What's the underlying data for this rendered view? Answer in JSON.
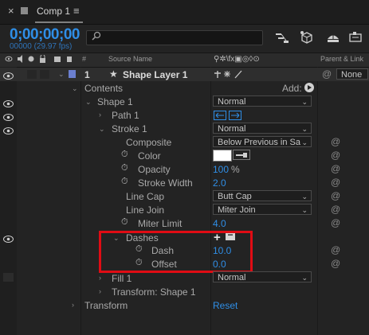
{
  "tab": {
    "close": "×",
    "title": "Comp 1",
    "menu": "≡"
  },
  "timecode": {
    "value": "0;00;00;00",
    "sub": "00000 (29.97 fps)"
  },
  "search": {
    "placeholder": ""
  },
  "columns": {
    "label": "#",
    "source_name": "Source Name",
    "parent_link": "Parent & Link",
    "switch_icons": "⚲✲\\fx▣◎◊⊙"
  },
  "layer": {
    "index": "1",
    "star": "★",
    "name": "Shape Layer 1",
    "parent_value": "None"
  },
  "rows": {
    "contents": "Contents",
    "add_label": "Add:",
    "shape1": "Shape 1",
    "shape1_mode": "Normal",
    "path1": "Path 1",
    "stroke1": "Stroke 1",
    "stroke1_mode": "Normal",
    "composite": "Composite",
    "composite_value": "Below Previous in Sa",
    "color": "Color",
    "opacity": "Opacity",
    "opacity_value": "100",
    "opacity_unit": "%",
    "stroke_width": "Stroke Width",
    "stroke_width_value": "2.0",
    "line_cap": "Line Cap",
    "line_cap_value": "Butt Cap",
    "line_join": "Line Join",
    "line_join_value": "Miter Join",
    "miter_limit": "Miter Limit",
    "miter_limit_value": "4.0",
    "dashes": "Dashes",
    "dash": "Dash",
    "dash_value": "10.0",
    "offset": "Offset",
    "offset_value": "0.0",
    "fill1": "Fill 1",
    "fill1_mode": "Normal",
    "transform_shape1": "Transform: Shape 1",
    "transform": "Transform",
    "reset": "Reset"
  },
  "glyphs": {
    "chevron": "›",
    "chevron_down": "⌄",
    "stopwatch": "⏱",
    "spiral": "@",
    "plus": "+",
    "minus": "−",
    "dd_arrow": "⌄"
  },
  "colors": {
    "accent_blue": "#2f8ee6",
    "highlight_red": "#e00c14",
    "stroke_color": "#ffffff"
  }
}
